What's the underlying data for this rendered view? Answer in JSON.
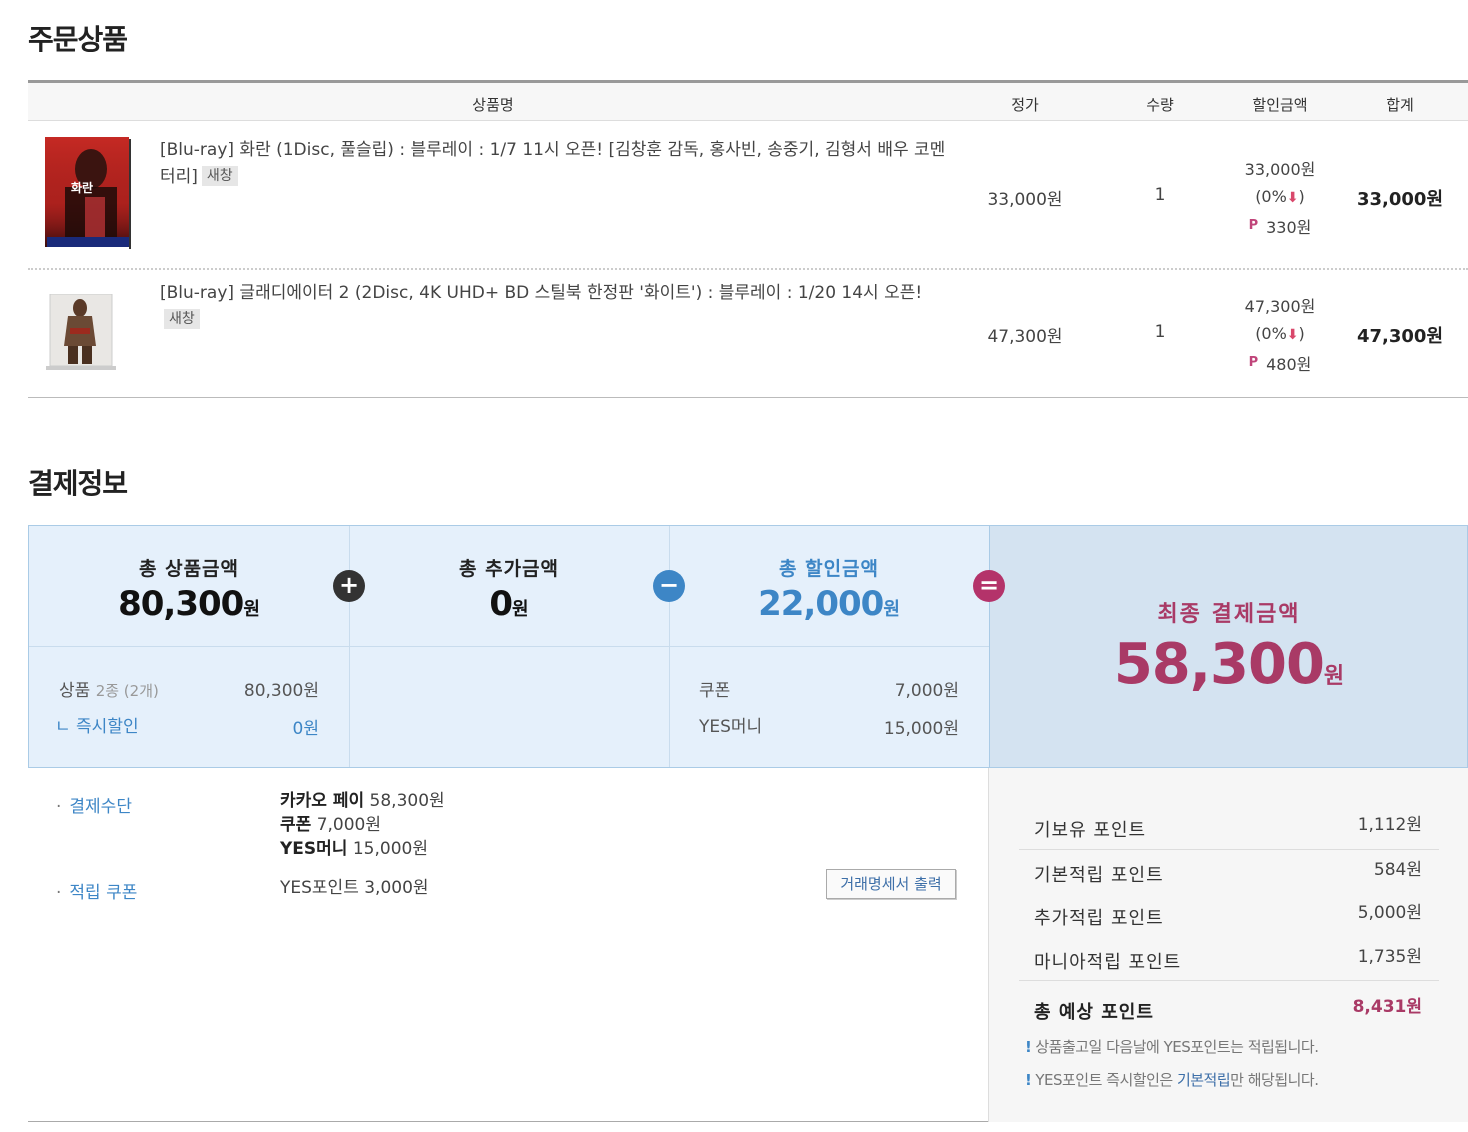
{
  "order_section": {
    "title": "주문상품",
    "headers": {
      "name": "상품명",
      "price": "정가",
      "qty": "수량",
      "discount": "할인금액",
      "total": "합계"
    },
    "items": [
      {
        "name": "[Blu-ray] 화란 (1Disc, 풀슬립) : 블루레이 : 1/7 11시 오픈! [김창훈 감독, 홍사빈, 송중기, 김형서 배우 코멘터리]",
        "badge": "새창",
        "price": "33,000원",
        "qty": "1",
        "discount_amount": "33,000원",
        "discount_rate": "(0%",
        "discount_rate_close": ")",
        "point": "330원",
        "total": "33,000원",
        "cover_text": "화란"
      },
      {
        "name": "[Blu-ray] 글래디에이터 2 (2Disc, 4K UHD+ BD 스틸북 한정판 '화이트') : 블루레이 : 1/20 14시 오픈!",
        "badge": "새창",
        "price": "47,300원",
        "qty": "1",
        "discount_amount": "47,300원",
        "discount_rate": "(0%",
        "discount_rate_close": ")",
        "point": "480원",
        "total": "47,300원"
      }
    ]
  },
  "payment_section": {
    "title": "결제정보",
    "total_product": {
      "label": "총 상품금액",
      "amount": "80,300",
      "unit": "원"
    },
    "total_extra": {
      "label": "총 추가금액",
      "amount": "0",
      "unit": "원"
    },
    "total_discount": {
      "label": "총 할인금액",
      "amount": "22,000",
      "unit": "원"
    },
    "final": {
      "label": "최종 결제금액",
      "amount": "58,300",
      "unit": "원"
    },
    "operators": {
      "plus": "+",
      "minus": "−",
      "equals": "="
    },
    "product_detail": {
      "label": "상품",
      "kinds": "2종 (2개)",
      "amount": "80,300원",
      "instant_label": "ㄴ 즉시할인",
      "instant_amount": "0원"
    },
    "discount_detail": [
      {
        "label": "쿠폰",
        "amount": "7,000원"
      },
      {
        "label": "YES머니",
        "amount": "15,000원"
      }
    ],
    "method": {
      "label": "결제수단",
      "lines": [
        {
          "name": "카카오 페이",
          "amount": "58,300원"
        },
        {
          "name": "쿠폰",
          "amount": "7,000원"
        },
        {
          "name": "YES머니",
          "amount": "15,000원"
        }
      ]
    },
    "coupon": {
      "label": "적립 쿠폰",
      "value": "YES포인트 3,000원"
    },
    "receipt_button": "거래명세서 출력"
  },
  "points": {
    "rows": [
      {
        "label": "기보유 포인트",
        "value": "1,112원"
      },
      {
        "label": "기본적립 포인트",
        "value": "584원"
      },
      {
        "label": "추가적립 포인트",
        "value": "5,000원"
      },
      {
        "label": "마니아적립 포인트",
        "value": "1,735원"
      }
    ],
    "total": {
      "label": "총 예상 포인트",
      "value": "8,431원"
    },
    "notes": {
      "bang": "!",
      "note1": "상품출고일 다음날에 YES포인트는 적립됩니다.",
      "note2_pre": "YES포인트 즉시할인은 ",
      "note2_hl": "기본적립",
      "note2_post": "만 해당됩니다."
    }
  },
  "colors": {
    "accent_blue": "#3d86c6",
    "accent_magenta": "#a93a66",
    "summary_bg": "#e5f0fb",
    "final_bg": "#d4e3f1"
  }
}
